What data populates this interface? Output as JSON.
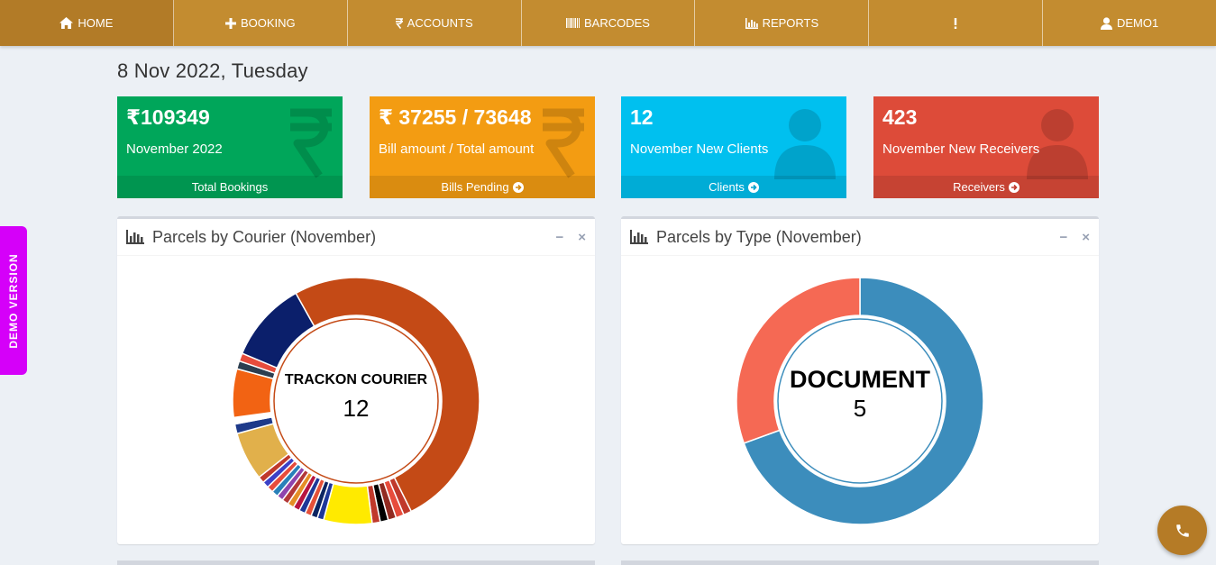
{
  "nav": [
    {
      "key": "home",
      "label": "HOME",
      "icon": "home-icon"
    },
    {
      "key": "booking",
      "label": "BOOKING",
      "icon": "plus-icon"
    },
    {
      "key": "accounts",
      "label": "ACCOUNTS",
      "icon": "rupee-icon"
    },
    {
      "key": "barcodes",
      "label": "BARCODES",
      "icon": "barcode-icon"
    },
    {
      "key": "reports",
      "label": "REPORTS",
      "icon": "bar-chart-icon"
    },
    {
      "key": "alert",
      "label": "",
      "icon": "exclamation-icon"
    },
    {
      "key": "user",
      "label": "DEMO1",
      "icon": "user-icon"
    }
  ],
  "date_heading": "8 Nov 2022, Tuesday",
  "boxes": [
    {
      "value": "₹109349",
      "subtitle": "November 2022",
      "footer": "Total Bookings",
      "icon": "rupee-icon",
      "color": "#00a65a"
    },
    {
      "value": "₹ 37255 / 73648",
      "subtitle": "Bill amount / Total amount",
      "footer": "Bills Pending",
      "icon": "rupee-icon",
      "color": "#f39c12"
    },
    {
      "value": "12",
      "subtitle": "November New Clients",
      "footer": "Clients",
      "icon": "user-icon",
      "color": "#00c0ef"
    },
    {
      "value": "423",
      "subtitle": "November New Receivers",
      "footer": "Receivers",
      "icon": "user-icon",
      "color": "#dd4b39"
    }
  ],
  "panels": {
    "courier": {
      "title": "Parcels by Courier (November)"
    },
    "type": {
      "title": "Parcels by Type (November)"
    }
  },
  "chart_data": [
    {
      "type": "pie",
      "title": "Parcels by Courier (November)",
      "center_label": "TRACKON COURIER",
      "center_value": "12",
      "slices": [
        {
          "value": 12,
          "color": "#c44a16"
        },
        {
          "value": 0.25,
          "color": "#c0392b"
        },
        {
          "value": 0.25,
          "color": "#e74c3c"
        },
        {
          "value": 0.25,
          "color": "#922b21"
        },
        {
          "value": 0.25,
          "color": "#000000"
        },
        {
          "value": 0.25,
          "color": "#c0392b"
        },
        {
          "value": 1.5,
          "color": "#ffea00"
        },
        {
          "value": 0.2,
          "color": "#1e3799"
        },
        {
          "value": 0.2,
          "color": "#0c2461"
        },
        {
          "value": 0.2,
          "color": "#e55039"
        },
        {
          "value": 0.2,
          "color": "#1e3799"
        },
        {
          "value": 0.2,
          "color": "#b71540"
        },
        {
          "value": 0.2,
          "color": "#e58e26"
        },
        {
          "value": 0.2,
          "color": "#b33939"
        },
        {
          "value": 0.2,
          "color": "#8e44ad"
        },
        {
          "value": 0.2,
          "color": "#2980b9"
        },
        {
          "value": 0.2,
          "color": "#e74c3c"
        },
        {
          "value": 0.2,
          "color": "#3c40c6"
        },
        {
          "value": 0.2,
          "color": "#c0392b"
        },
        {
          "value": 1.5,
          "color": "#e1b04b"
        },
        {
          "value": 0.3,
          "color": "#1e3a8a"
        },
        {
          "value": 0.2,
          "color": "#ffffff"
        },
        {
          "value": 1.5,
          "color": "#f26313"
        },
        {
          "value": 0.25,
          "color": "#2c3e50"
        },
        {
          "value": 0.25,
          "color": "#e74c3c"
        },
        {
          "value": 2.5,
          "color": "#0b1f6b"
        }
      ]
    },
    {
      "type": "pie",
      "title": "Parcels by Type (November)",
      "center_label": "DOCUMENT",
      "center_value": "5",
      "slices": [
        {
          "value": 5,
          "color": "#3c8dbc"
        },
        {
          "value": 2.2,
          "color": "#f56954"
        }
      ]
    }
  ]
}
